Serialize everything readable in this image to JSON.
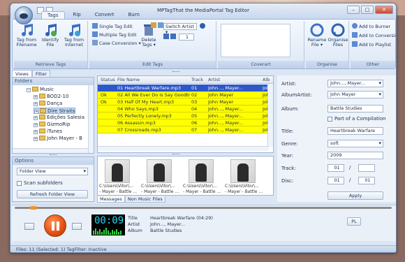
{
  "window": {
    "title": "MPTagThat the MediaPortal Tag Editor"
  },
  "tabs": [
    "Tags",
    "Rip",
    "Convert",
    "Burn"
  ],
  "ribbon": {
    "retrieve": {
      "label": "Retrieve Tags",
      "tag_from_filename": "Tag from Filename",
      "identify_file": "Identify File",
      "tag_from_internet": "Tag from Internet"
    },
    "edit": {
      "label": "Edit Tags",
      "single": "Single Tag Edit",
      "multiple": "Multiple Tag Edit",
      "case": "Case Conversion",
      "delete": "Delete Tags",
      "switch_artist": "Switch Artist",
      "number": "1"
    },
    "coverart": {
      "label": "Coverart"
    },
    "organise": {
      "label": "Organise",
      "rename": "Rename File",
      "organise_files": "Organise Files"
    },
    "other": {
      "label": "Other",
      "add_burner": "Add to Burner",
      "add_conversion": "Add to Conversion",
      "add_playlist": "Add to Playlist"
    }
  },
  "left": {
    "tabs": [
      "Views",
      "Filter"
    ],
    "folders_header": "Folders",
    "tree": [
      "Music",
      "BOD2-10",
      "Dança",
      "Dire Straits",
      "Edições Salesia",
      "GizmoRip",
      "iTunes",
      "John Mayer - B"
    ],
    "options_header": "Options",
    "view": "Folder View",
    "scan_subfolders": "Scan subfolders",
    "refresh": "Refresh Folder View"
  },
  "grid": {
    "columns": [
      "Status",
      "File Name",
      "Track",
      "Artist",
      "Alb"
    ],
    "rows": [
      {
        "status": "",
        "file": "01 Heartbreak Warfare.mp3",
        "track": "01",
        "artist": "John..., Mayer...",
        "alb": "John"
      },
      {
        "status": "Ok",
        "file": "02 All We Ever Do Is Say Goodbye.mp3",
        "track": "02",
        "artist": "John Mayer",
        "alb": "John"
      },
      {
        "status": "Ok",
        "file": "03 Half Of My Heart.mp3",
        "track": "03",
        "artist": "John Mayer",
        "alb": "John"
      },
      {
        "status": "",
        "file": "04 Who Says.mp3",
        "track": "04",
        "artist": "John..., Mayer...",
        "alb": "John"
      },
      {
        "status": "",
        "file": "05 Perfectly Lonely.mp3",
        "track": "05",
        "artist": "John..., Mayer...",
        "alb": "John"
      },
      {
        "status": "",
        "file": "06 Assassin.mp3",
        "track": "06",
        "artist": "John..., Mayer...",
        "alb": "John"
      },
      {
        "status": "",
        "file": "07 Crossroads.mp3",
        "track": "07",
        "artist": "John..., Mayer...",
        "alb": "John"
      }
    ]
  },
  "thumbs": [
    {
      "line1": "C:\\Users\\Vitor\\...",
      "line2": "- Mayer - Battle ..."
    },
    {
      "line1": "C:\\Users\\Vitor\\...",
      "line2": "- Mayer - Battle ..."
    },
    {
      "line1": "C:\\Users\\Vitor\\...",
      "line2": "- Mayer - Battle ..."
    },
    {
      "line1": "C:\\Users\\Vitor\\...",
      "line2": "- Mayer - Battle ..."
    }
  ],
  "bottom_tabs": [
    "Messages",
    "Non Music Files"
  ],
  "tagedit": {
    "artist_label": "Artist:",
    "artist": "John..., Mayer...",
    "albumartist_label": "AlbumArtist:",
    "albumartist": "John Mayer",
    "album_label": "Album:",
    "album": "Battle Studies",
    "compilation": "Part of a Compilation",
    "title_label": "Title:",
    "title": "Heartbreak Warfare",
    "genre_label": "Genre:",
    "genre": "soft",
    "year_label": "Year:",
    "year": "2009",
    "track_label": "Track:",
    "track": "01",
    "track_total": "",
    "disc_label": "Disc:",
    "disc": "01",
    "disc_total": "01",
    "sep": "/",
    "apply": "Apply"
  },
  "player": {
    "time": "00:09",
    "progress": 0.04,
    "title_label": "Title",
    "title": "Heartbreak Warfare (04:29)",
    "artist_label": "Artist",
    "artist": "John..., Mayer...",
    "album_label": "Album",
    "album": "Battle Studies",
    "pl": "PL"
  },
  "status": "Files: 11 (Selected: 1)  TagFilter: Inactive",
  "colors": {
    "row_highlight": "#ffff00",
    "selected_row": "#2d58c8",
    "accent": "#e24d0e",
    "lcd": "#26d7f0"
  }
}
